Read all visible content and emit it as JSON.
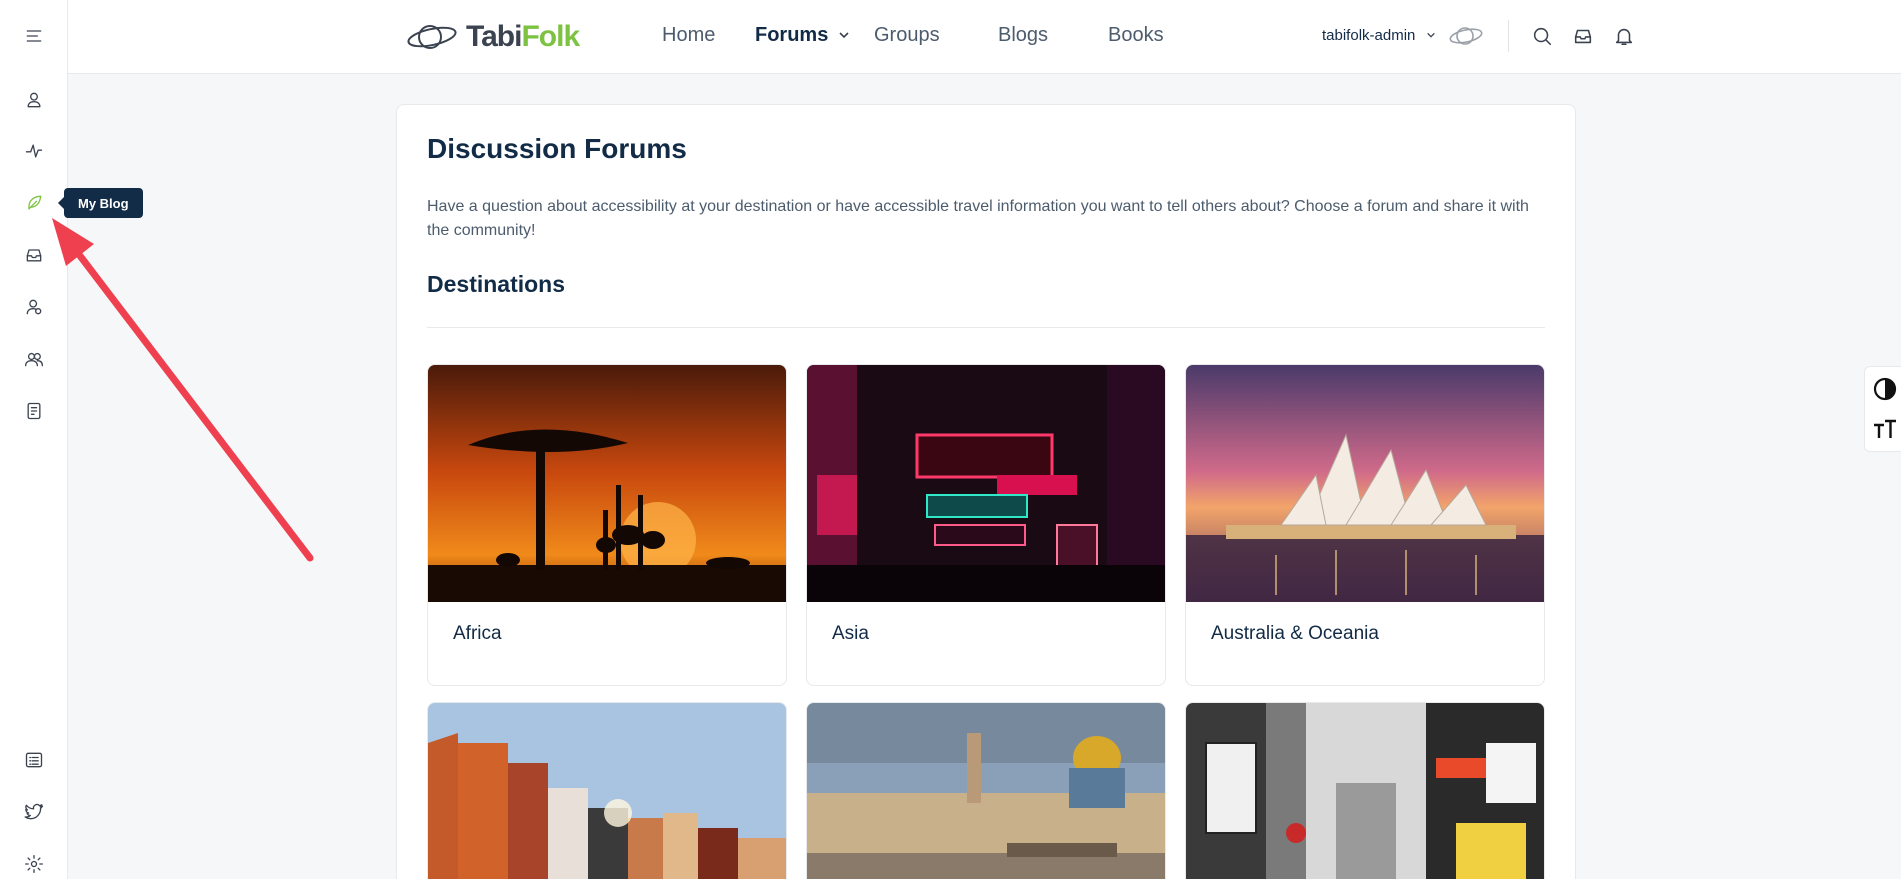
{
  "brand": {
    "logo_part1": "Tabi",
    "logo_part2": "Folk"
  },
  "nav": [
    {
      "label": "Home"
    },
    {
      "label": "Forums"
    },
    {
      "label": "Groups"
    },
    {
      "label": "Blogs"
    },
    {
      "label": "Books"
    }
  ],
  "user": {
    "name": "tabifolk-admin"
  },
  "rail": {
    "tooltip": "My Blog",
    "icons": [
      "menu-icon",
      "profile-icon",
      "activity-icon",
      "blog-feather-icon",
      "inbox-icon",
      "connections-icon",
      "groups-icon",
      "forums-icon",
      "list-icon",
      "twitter-icon",
      "settings-icon"
    ]
  },
  "page": {
    "title": "Discussion Forums",
    "intro": "Have a question about accessibility at your destination or have accessible travel information you want to tell others about? Choose a forum and share it with the community!",
    "section": "Destinations",
    "forums": [
      {
        "name": "Africa"
      },
      {
        "name": "Asia"
      },
      {
        "name": "Australia & Oceania"
      },
      {
        "name": ""
      },
      {
        "name": ""
      },
      {
        "name": ""
      }
    ]
  },
  "colors": {
    "accent": "#7dc242",
    "text": "#122b46",
    "arrow": "#ef4050",
    "tooltip_bg": "#122b46"
  }
}
